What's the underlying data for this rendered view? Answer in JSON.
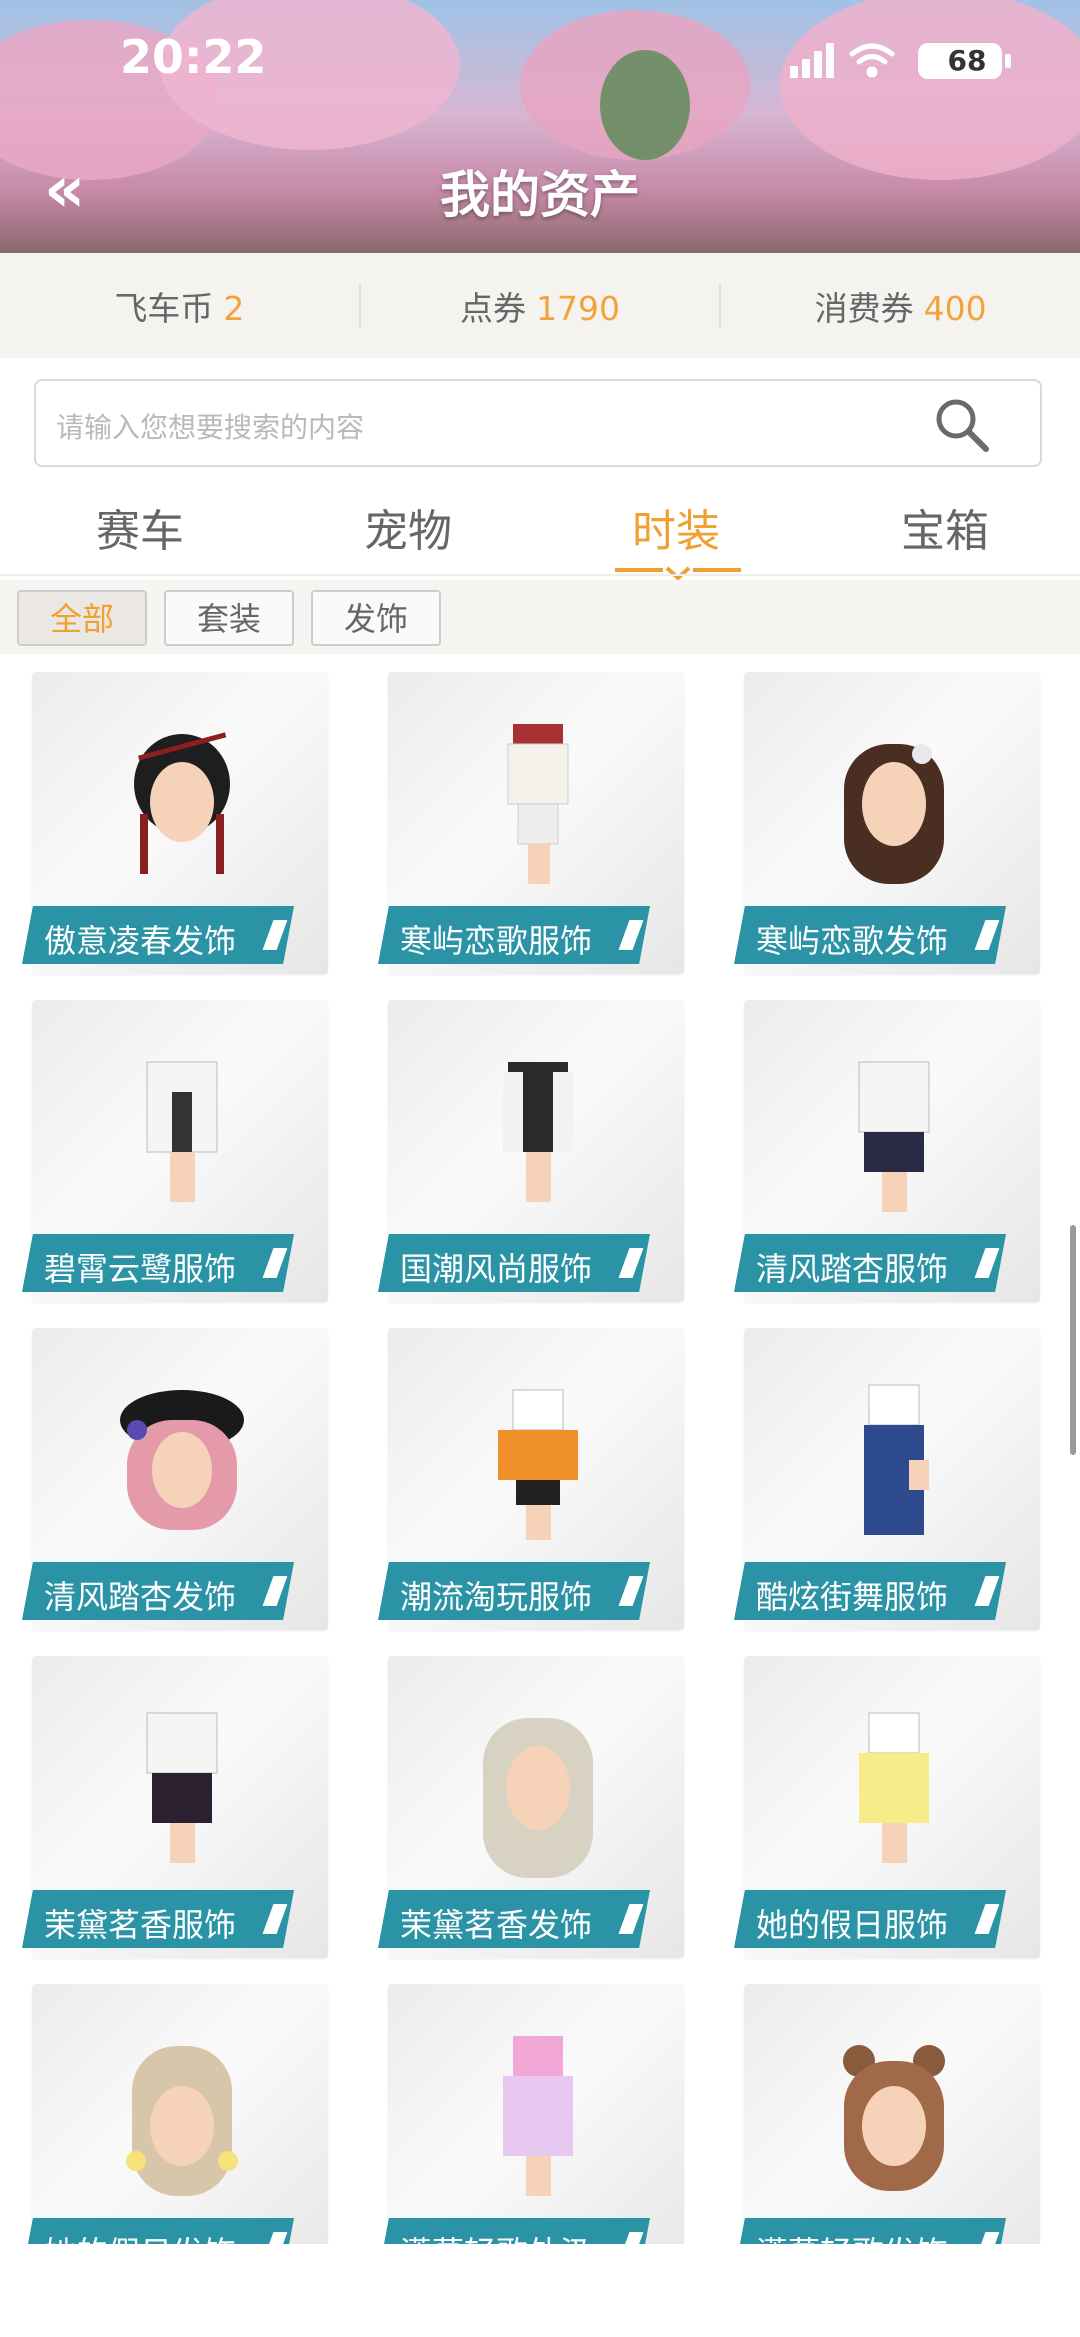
{
  "status": {
    "time": "20:22",
    "battery": "68"
  },
  "header": {
    "title": "我的资产",
    "back_icon": "chevron-double-left-icon"
  },
  "currency": [
    {
      "label": "飞车币",
      "value": "2"
    },
    {
      "label": "点券",
      "value": "1790"
    },
    {
      "label": "消费券",
      "value": "400"
    }
  ],
  "search": {
    "placeholder": "请输入您想要搜索的内容"
  },
  "tabs": [
    "赛车",
    "宠物",
    "时装",
    "宝箱"
  ],
  "active_tab": "时装",
  "filters": [
    "全部",
    "套装",
    "发饰"
  ],
  "active_filter": "全部",
  "items": [
    "傲意凌春发饰",
    "寒屿恋歌服饰",
    "寒屿恋歌发饰",
    "碧霄云鹭服饰",
    "国潮风尚服饰",
    "清风踏杏服饰",
    "清风踏杏发饰",
    "潮流淘玩服饰",
    "酷炫街舞服饰",
    "茉黛茗香服饰",
    "茉黛茗香发饰",
    "她的假日服饰",
    "她的假日发饰",
    "潇慕轻歌外汲",
    "潇慕轻歌发饰"
  ],
  "colors": {
    "accent": "#f0a030",
    "label_bg": "#2a93a5"
  }
}
